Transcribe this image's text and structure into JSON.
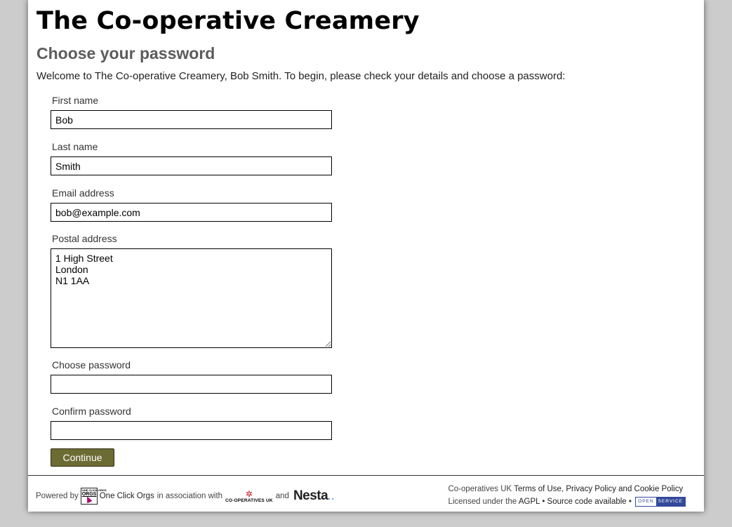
{
  "header": {
    "site_title": "The Co-operative Creamery",
    "page_heading": "Choose your password",
    "intro": "Welcome to The Co-operative Creamery, Bob Smith. To begin, please check your details and choose a password:"
  },
  "form": {
    "first_name": {
      "label": "First name",
      "value": "Bob"
    },
    "last_name": {
      "label": "Last name",
      "value": "Smith"
    },
    "email": {
      "label": "Email address",
      "value": "bob@example.com"
    },
    "postal_address": {
      "label": "Postal address",
      "value": "1 High Street\nLondon\nN1 1AA"
    },
    "password": {
      "label": "Choose password",
      "value": ""
    },
    "password_confirm": {
      "label": "Confirm password",
      "value": ""
    },
    "submit_label": "Continue"
  },
  "footer": {
    "powered_by": "Powered by",
    "one_click_orgs_logo_text": "ONE CLICK ORGS",
    "one_click_orgs": "One Click Orgs",
    "in_association_with": "in association with",
    "coops_uk_logo_text": "CO-OPERATIVES UK",
    "and": "and",
    "nesta": "Nesta",
    "coops_uk": "Co-operatives UK",
    "terms_of_use": "Terms of Use",
    "comma": ",",
    "privacy_policy": "Privacy Policy",
    "and2": "and",
    "cookie_policy": "Cookie Policy",
    "licensed_under": "Licensed under the",
    "agpl": "AGPL",
    "bullet": "•",
    "source_code": "Source code available",
    "open_service_a": "OPEN",
    "open_service_b": "SERVICE"
  }
}
